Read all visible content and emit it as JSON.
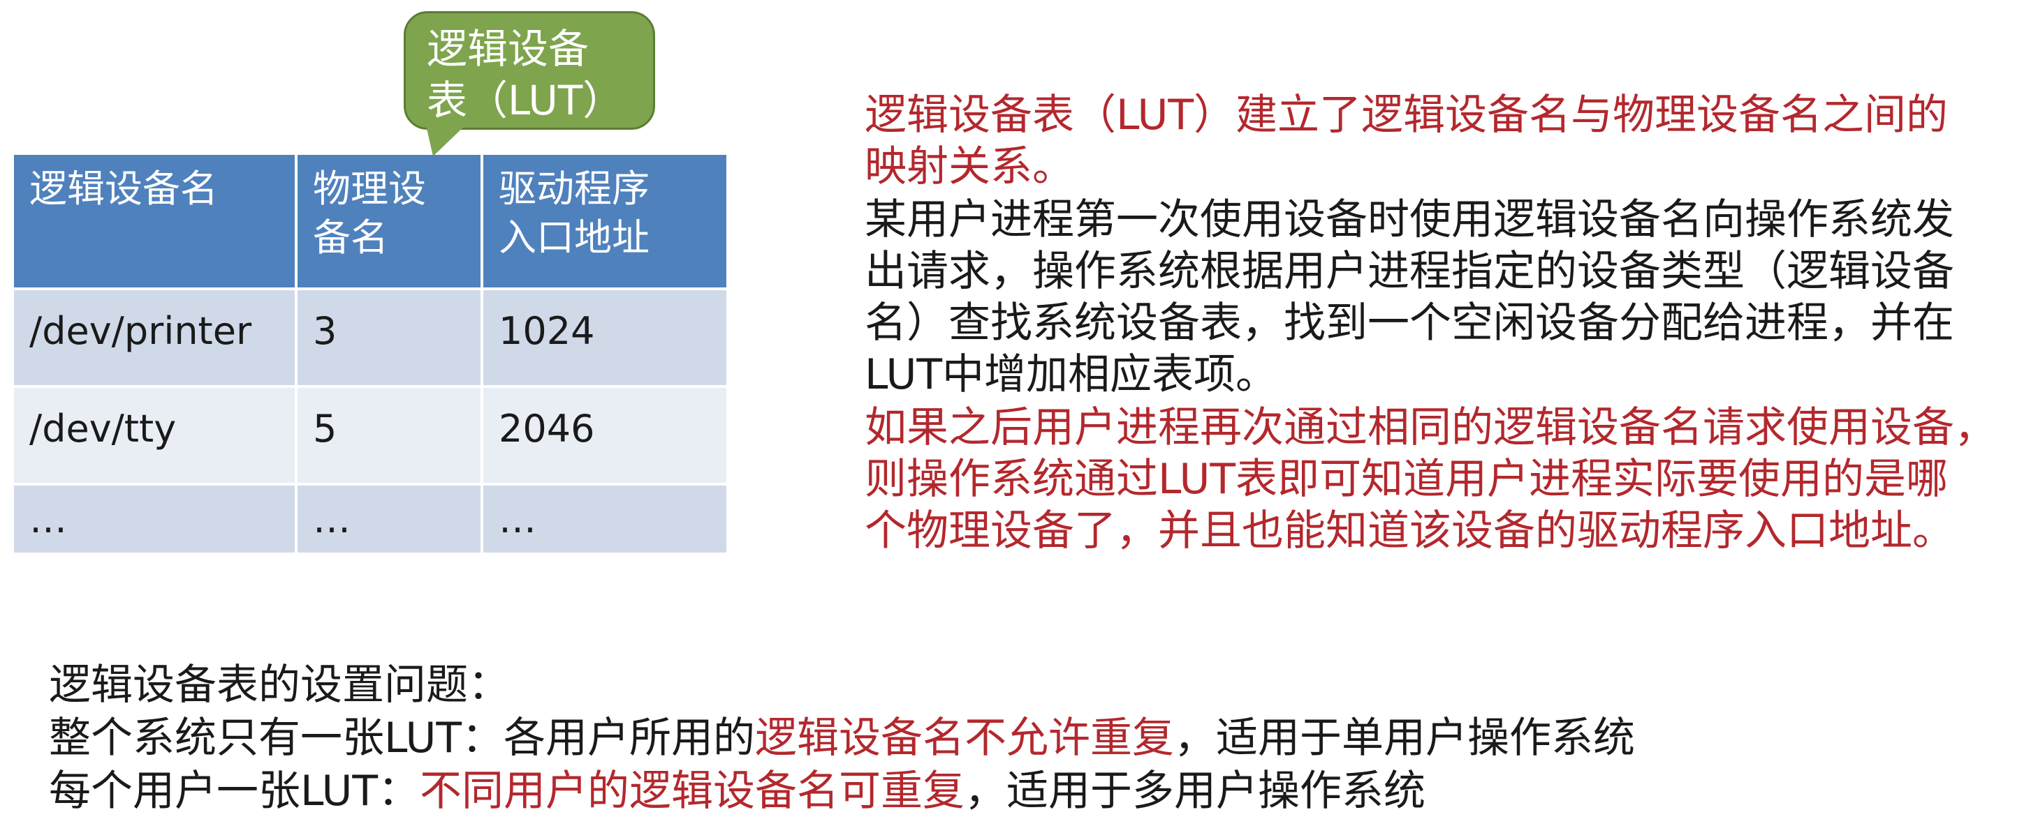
{
  "callout": {
    "line1": "逻辑设备",
    "line2": "表（LUT）"
  },
  "table": {
    "headers": [
      {
        "line1": "逻辑设备名",
        "line2": ""
      },
      {
        "line1": "物理设",
        "line2": "备名"
      },
      {
        "line1": "驱动程序",
        "line2": "入口地址"
      }
    ],
    "rows": [
      [
        "/dev/printer",
        "3",
        "1024"
      ],
      [
        "/dev/tty",
        "5",
        "2046"
      ],
      [
        "…",
        "…",
        "…"
      ]
    ]
  },
  "explanation": {
    "p1_lines": [
      "逻辑设备表（LUT）建立了逻辑设备名与物理设备名之间的",
      "映射关系。"
    ],
    "p2_lines": [
      "某用户进程第一次使用设备时使用逻辑设备名向操作系统发",
      "出请求，操作系统根据用户进程指定的设备类型（逻辑设备",
      "名）查找系统设备表，找到一个空闲设备分配给进程，并在",
      "LUT中增加相应表项。"
    ],
    "p3_lines": [
      "如果之后用户进程再次通过相同的逻辑设备名请求使用设备，",
      "则操作系统通过LUT表即可知道用户进程实际要使用的是哪",
      "个物理设备了，并且也能知道该设备的驱动程序入口地址。"
    ]
  },
  "issues": {
    "title": "逻辑设备表的设置问题：",
    "item1": {
      "prefix": "整个系统只有一张LUT：各用户所用的",
      "highlight": "逻辑设备名不允许重复",
      "suffix": "，适用于单用户操作系统"
    },
    "item2": {
      "prefix": "每个用户一张LUT：",
      "highlight": "不同用户的逻辑设备名可重复",
      "suffix": "，适用于多用户操作系统"
    }
  },
  "colors": {
    "header_blue": "#4f81bd",
    "row_odd": "#d0d9e8",
    "row_even": "#e9edf4",
    "callout_green": "#7ea44d",
    "highlight_red": "#b3282d"
  }
}
